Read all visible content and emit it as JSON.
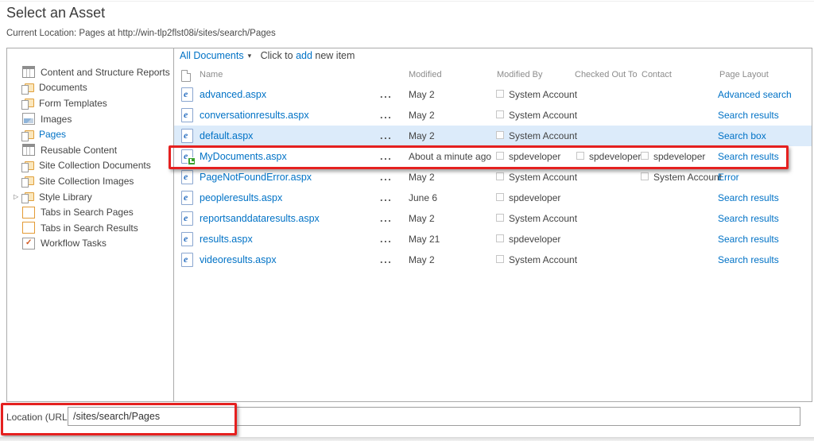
{
  "header": {
    "title": "Select an Asset",
    "current_location": "Current Location: Pages at http://win-tlp2flst08i/sites/search/Pages"
  },
  "sidebar": {
    "items": [
      {
        "label": "Content and Structure Reports",
        "icon": "list-icon",
        "selected": false
      },
      {
        "label": "Documents",
        "icon": "folder-icon",
        "selected": false
      },
      {
        "label": "Form Templates",
        "icon": "folder-icon",
        "selected": false
      },
      {
        "label": "Images",
        "icon": "image-library-icon",
        "selected": false
      },
      {
        "label": "Pages",
        "icon": "folder-icon",
        "selected": true
      },
      {
        "label": "Reusable Content",
        "icon": "list-icon",
        "selected": false
      },
      {
        "label": "Site Collection Documents",
        "icon": "folder-icon",
        "selected": false
      },
      {
        "label": "Site Collection Images",
        "icon": "folder-icon",
        "selected": false
      },
      {
        "label": "Style Library",
        "icon": "folder-icon",
        "selected": false,
        "expandable": true
      },
      {
        "label": "Tabs in Search Pages",
        "icon": "table-icon",
        "selected": false
      },
      {
        "label": "Tabs in Search Results",
        "icon": "table-icon",
        "selected": false
      },
      {
        "label": "Workflow Tasks",
        "icon": "tasks-icon",
        "selected": false
      }
    ]
  },
  "toolbar": {
    "view_selector": "All Documents",
    "add_item_prefix": "Click to ",
    "add_item_link": "add",
    "add_item_suffix": " new item"
  },
  "table": {
    "columns": {
      "name": "Name",
      "modified": "Modified",
      "modified_by": "Modified By",
      "checked_out_to": "Checked Out To",
      "contact": "Contact",
      "page_layout": "Page Layout"
    },
    "rows": [
      {
        "name": "advanced.aspx",
        "modified": "May 2",
        "modified_by": "System Account",
        "checked_out_to": "",
        "contact": "",
        "page_layout": "Advanced search",
        "highlighted": false,
        "annotated": false
      },
      {
        "name": "conversationresults.aspx",
        "modified": "May 2",
        "modified_by": "System Account",
        "checked_out_to": "",
        "contact": "",
        "page_layout": "Search results",
        "highlighted": false,
        "annotated": false
      },
      {
        "name": "default.aspx",
        "modified": "May 2",
        "modified_by": "System Account",
        "checked_out_to": "",
        "contact": "",
        "page_layout": "Search box",
        "highlighted": true,
        "annotated": false
      },
      {
        "name": "MyDocuments.aspx",
        "modified": "About a minute ago",
        "modified_by": "spdeveloper",
        "checked_out_to": "spdeveloper",
        "contact": "spdeveloper",
        "page_layout": "Search results",
        "highlighted": false,
        "annotated": true,
        "new_badge": true
      },
      {
        "name": "PageNotFoundError.aspx",
        "modified": "May 2",
        "modified_by": "System Account",
        "checked_out_to": "",
        "contact": "System Account",
        "page_layout": "Error",
        "highlighted": false,
        "annotated": false
      },
      {
        "name": "peopleresults.aspx",
        "modified": "June 6",
        "modified_by": "spdeveloper",
        "checked_out_to": "",
        "contact": "",
        "page_layout": "Search results",
        "highlighted": false,
        "annotated": false
      },
      {
        "name": "reportsanddataresults.aspx",
        "modified": "May 2",
        "modified_by": "System Account",
        "checked_out_to": "",
        "contact": "",
        "page_layout": "Search results",
        "highlighted": false,
        "annotated": false
      },
      {
        "name": "results.aspx",
        "modified": "May 21",
        "modified_by": "spdeveloper",
        "checked_out_to": "",
        "contact": "",
        "page_layout": "Search results",
        "highlighted": false,
        "annotated": false
      },
      {
        "name": "videoresults.aspx",
        "modified": "May 2",
        "modified_by": "System Account",
        "checked_out_to": "",
        "contact": "",
        "page_layout": "Search results",
        "highlighted": false,
        "annotated": false
      }
    ]
  },
  "ui": {
    "ellipsis": "...",
    "dropdown_caret": "▾",
    "expand_arrow": "▷"
  },
  "footer": {
    "location_label": "Location (URL):",
    "location_value": "/sites/search/Pages"
  },
  "colors": {
    "link": "#0072c6",
    "text": "#444444",
    "header_text": "#8c8c8c",
    "row_highlight": "#dcebfa",
    "annotation_red": "#e5201f"
  }
}
